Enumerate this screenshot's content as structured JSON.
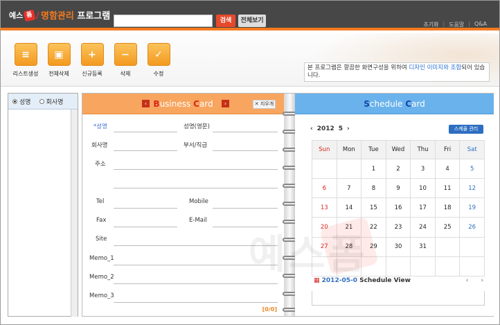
{
  "header": {
    "logo_text": "예스",
    "logo_mark": "폼",
    "title_part1": "명함관리",
    "title_part2": " 프로그램",
    "search_placeholder": "",
    "search_button": "검색",
    "all_view_button": "전체보기",
    "links": [
      "초기화",
      "도움말",
      "Q&A"
    ]
  },
  "toolbar": {
    "buttons": [
      {
        "label": "리스트생성",
        "icon": "list-create-icon"
      },
      {
        "label": "전체삭제",
        "icon": "delete-all-icon"
      },
      {
        "label": "신규등록",
        "icon": "add-icon"
      },
      {
        "label": "삭제",
        "icon": "minus-icon"
      },
      {
        "label": "수정",
        "icon": "check-icon"
      }
    ],
    "notice_text_1": "본 프로그램은 깔끔한 화면구성을 위하여 ",
    "notice_highlight": "디자인 이미지와 조합",
    "notice_text_2": "되어 있습니다."
  },
  "left_panel": {
    "radio_name": "성명",
    "radio_company": "회사명",
    "selected": "성명"
  },
  "business_card": {
    "title_cap1": "B",
    "title_rest1": "usiness ",
    "title_cap2": "C",
    "title_rest2": "ard",
    "clear_button": "✕ 지우개",
    "fields": {
      "name": "*성명",
      "name_en": "성명(영문)",
      "company": "회사명",
      "dept": "부서/직급",
      "address": "주소",
      "tel": "Tel",
      "mobile": "Mobile",
      "fax": "Fax",
      "email": "E-Mail",
      "site": "Site",
      "memo1": "Memo_1",
      "memo2": "Memo_2",
      "memo3": "Memo_3"
    },
    "counter": "[0/0]"
  },
  "schedule_card": {
    "title_cap1": "S",
    "title_rest1": "chedule ",
    "title_cap2": "C",
    "title_rest2": "ard",
    "year": "2012",
    "month": "5",
    "manage_button": "스케쥴 관리",
    "weekdays": [
      "Sun",
      "Mon",
      "Tue",
      "Wed",
      "Thu",
      "Fri",
      "Sat"
    ],
    "weeks": [
      [
        "",
        "",
        "1",
        "2",
        "3",
        "4",
        "5"
      ],
      [
        "6",
        "7",
        "8",
        "9",
        "10",
        "11",
        "12"
      ],
      [
        "13",
        "14",
        "15",
        "16",
        "17",
        "18",
        "19"
      ],
      [
        "20",
        "21",
        "22",
        "23",
        "24",
        "25",
        "26"
      ],
      [
        "27",
        "28",
        "29",
        "30",
        "31",
        "",
        ""
      ],
      [
        "",
        "",
        "",
        "",
        "",
        "",
        ""
      ]
    ],
    "view_date": "2012-05-0",
    "view_label": " Schedule View"
  },
  "watermark": "예스폼",
  "colors": {
    "accent_orange": "#f47a20",
    "header_bg": "#474747",
    "card_orange": "#f8a55f",
    "card_blue": "#6ab2ec",
    "sunday": "#d7281d",
    "saturday": "#2e6ec2"
  }
}
